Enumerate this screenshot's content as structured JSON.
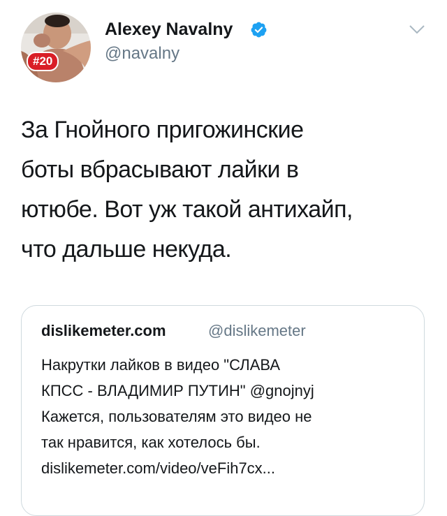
{
  "tweet": {
    "author": {
      "name": "Alexey Navalny",
      "handle": "@navalny",
      "avatar_badge": "#20",
      "verified_icon": "verified-badge-icon"
    },
    "menu_icon": "chevron-down-icon",
    "text_lines": [
      "За Гнойного пригожинские",
      "боты вбрасывают лайки в",
      "ютюбе. Вот уж такой антихайп,",
      "что дальше некуда."
    ]
  },
  "quoted_tweet": {
    "name": "dislikemeter.com",
    "handle": "@dislikemeter",
    "text_lines": [
      "Накрутки лайков в видео \"СЛАВА",
      "КПСС - ВЛАДИМИР ПУТИН\" @gnojnyj",
      "Кажется, пользователям это видео не",
      "так нравится, как хотелось бы.",
      "dislikemeter.com/video/veFih7cx..."
    ]
  },
  "colors": {
    "text_primary": "#14171a",
    "text_secondary": "#657786",
    "verified_blue": "#1da1f2",
    "badge_red": "#d91e26",
    "card_border": "#cfd9de"
  }
}
